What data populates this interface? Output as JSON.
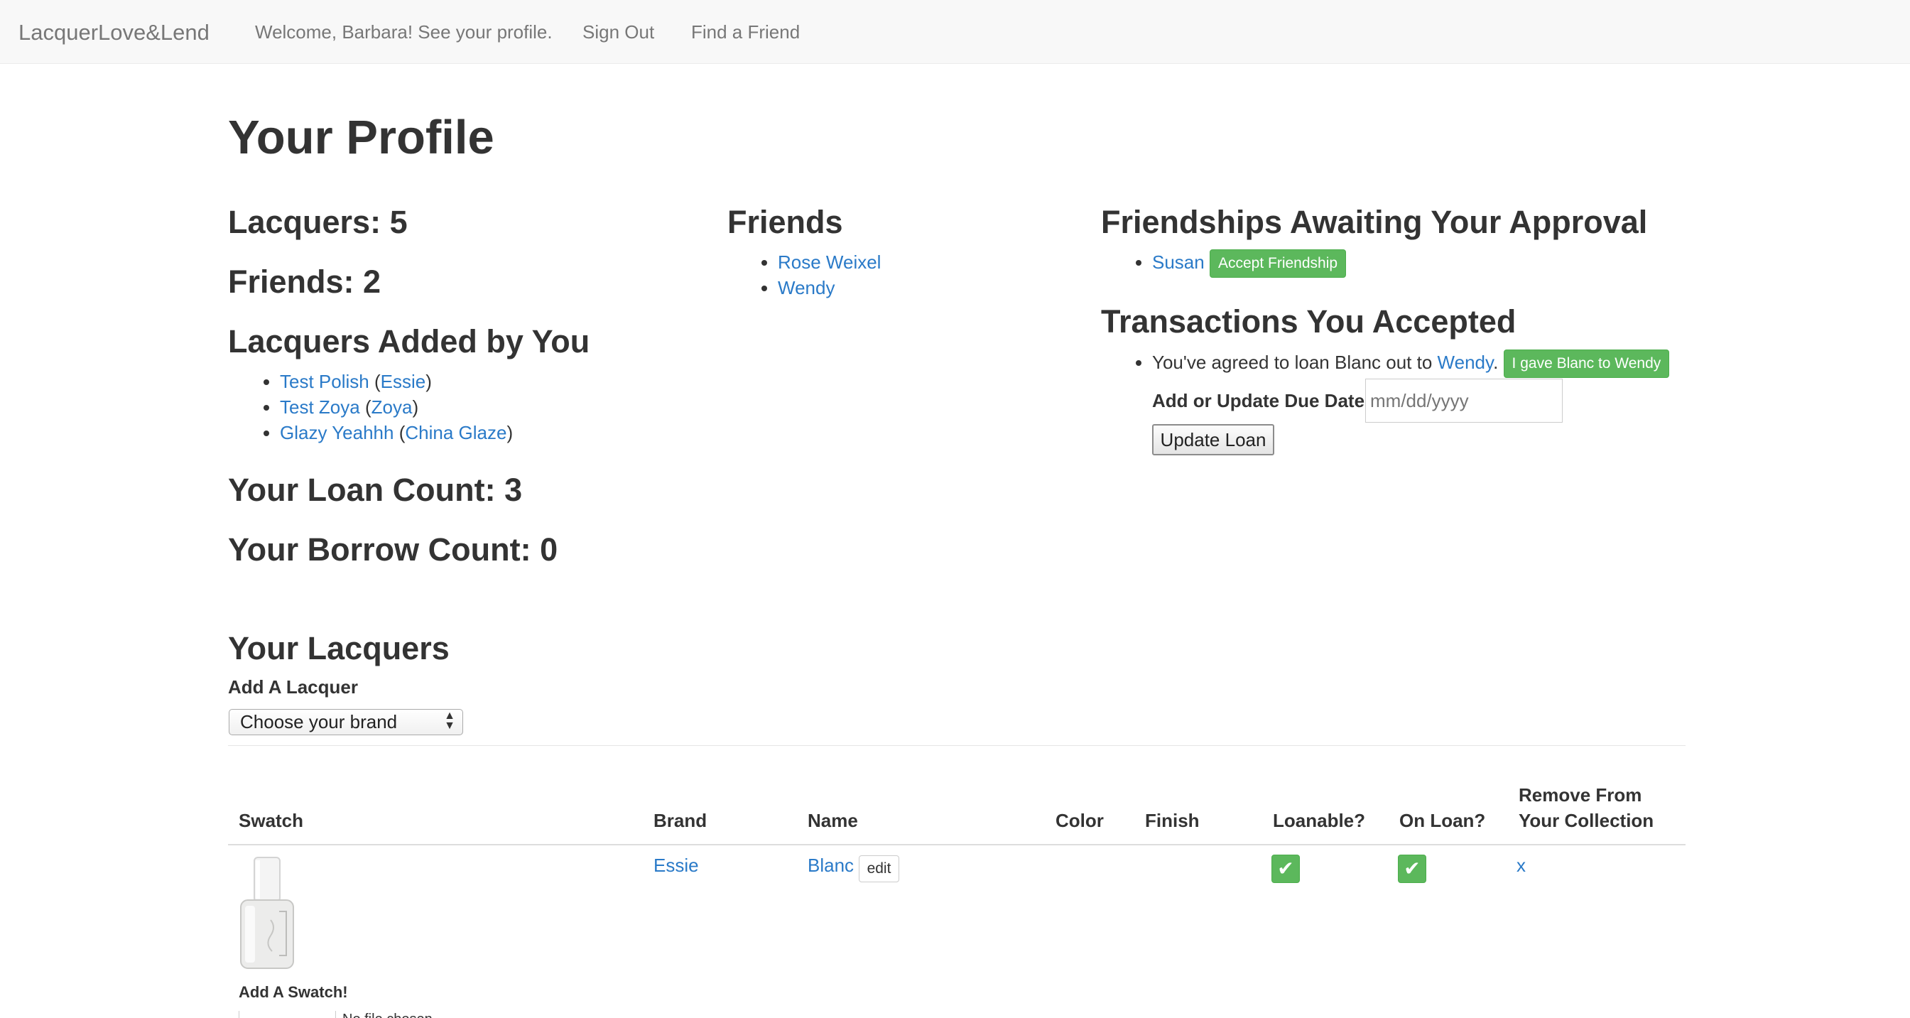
{
  "nav": {
    "brand": "LacquerLove&Lend",
    "welcome": "Welcome, Barbara! See your profile.",
    "sign_out": "Sign Out",
    "find_friend": "Find a Friend"
  },
  "profile": {
    "title": "Your Profile",
    "lacquers_count": "Lacquers: 5",
    "friends_count": "Friends: 2",
    "added_heading": "Lacquers Added by You",
    "added": [
      {
        "name": "Test Polish",
        "brand": "Essie"
      },
      {
        "name": "Test Zoya",
        "brand": "Zoya"
      },
      {
        "name": "Glazy Yeahhh",
        "brand": "China Glaze"
      }
    ],
    "loan_count": "Your Loan Count: 3",
    "borrow_count": "Your Borrow Count: 0"
  },
  "friends": {
    "heading": "Friends",
    "list": [
      "Rose Weixel",
      "Wendy"
    ]
  },
  "approvals": {
    "heading": "Friendships Awaiting Your Approval",
    "name": "Susan",
    "button": "Accept Friendship"
  },
  "transactions": {
    "heading": "Transactions You Accepted",
    "text_prefix": "You've agreed to loan Blanc out to",
    "friend": "Wendy",
    "text_suffix": ".",
    "gave_button": "I gave Blanc to Wendy",
    "due_label": "Add or Update Due Date",
    "due_placeholder": "mm/dd/yyyy",
    "update_button": "Update Loan"
  },
  "lacquers": {
    "heading": "Your Lacquers",
    "add_label": "Add A Lacquer",
    "brand_select": "Choose your brand",
    "columns": {
      "swatch": "Swatch",
      "brand": "Brand",
      "name": "Name",
      "color": "Color",
      "finish": "Finish",
      "loanable": "Loanable?",
      "on_loan": "On Loan?",
      "remove_line1": "Remove From",
      "remove_line2": "Your Collection"
    },
    "rows": [
      {
        "brand": "Essie",
        "name": "Blanc",
        "edit": "edit",
        "loanable_icon": "check-icon",
        "on_loan_icon": "check-icon",
        "remove": "x",
        "add_swatch": "Add A Swatch!",
        "partial_text": "No file chosen"
      }
    ]
  },
  "colors": {
    "link": "#2a7ac8",
    "success": "#5cb85c",
    "navbar_bg": "#f8f8f8",
    "nav_text": "#777777"
  }
}
